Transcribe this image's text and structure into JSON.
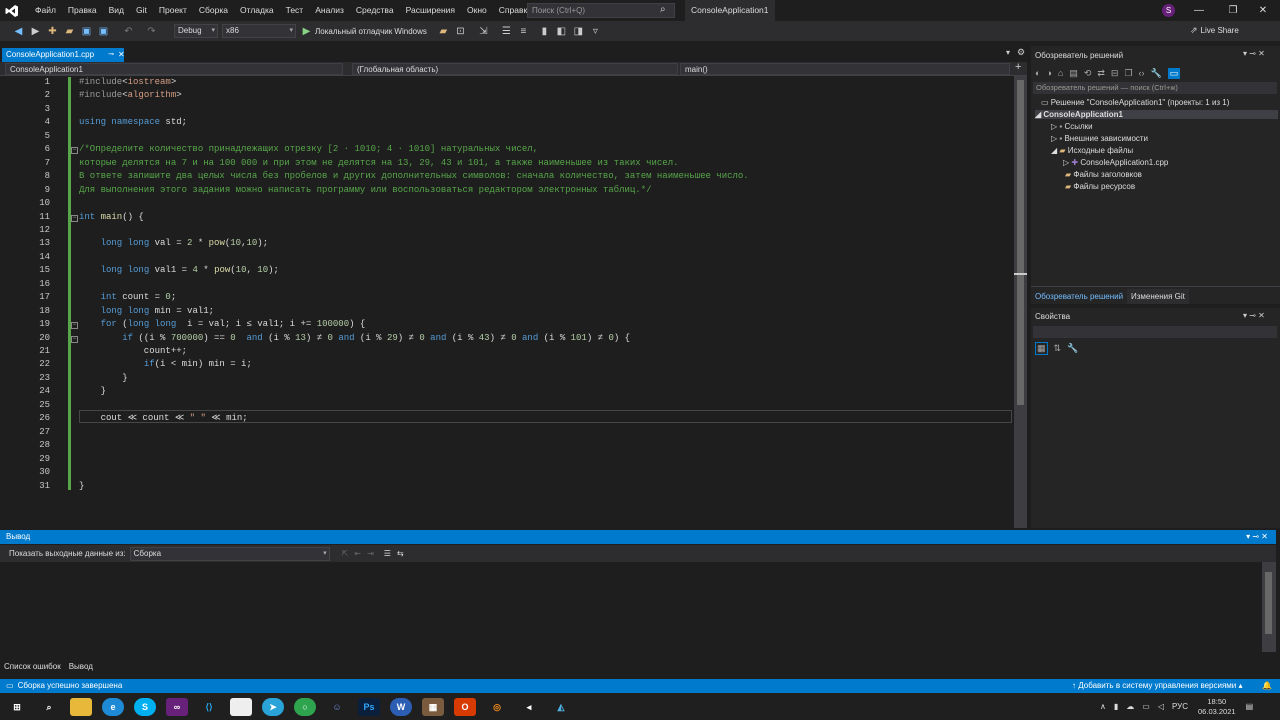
{
  "menu": [
    "Файл",
    "Правка",
    "Вид",
    "Git",
    "Проект",
    "Сборка",
    "Отладка",
    "Тест",
    "Анализ",
    "Средства",
    "Расширения",
    "Окно",
    "Справка"
  ],
  "search_placeholder": "Поиск (Ctrl+Q)",
  "app_title": "ConsoleApplication1",
  "avatar_letter": "S",
  "toolbar": {
    "config": "Debug",
    "platform": "x86",
    "debugger": "Локальный отладчик Windows",
    "live_share": "Live Share"
  },
  "tab": {
    "filename": "ConsoleApplication1.cpp"
  },
  "nav": {
    "project": "ConsoleApplication1",
    "scope": "(Глобальная область)",
    "member": "main()"
  },
  "code_lines": [
    "#include<iostream>",
    "#include<algorithm>",
    "",
    "using namespace std;",
    "",
    "/*Определите количество принадлежащих отрезку [2 · 1010; 4 · 1010] натуральных чисел,",
    "которые делятся на 7 и на 100 000 и при этом не делятся на 13, 29, 43 и 101, а также наименьшее из таких чисел.",
    "В ответе запишите два целых числа без пробелов и других дополнительных символов: сначала количество, затем наименьшее число.",
    "Для выполнения этого задания можно написать программу или воспользоваться редактором электронных таблиц.*/",
    "",
    "int main() {",
    "",
    "    long long val = 2 * pow(10,10);",
    "",
    "    long long val1 = 4 * pow(10, 10);",
    "",
    "    int count = 0;",
    "    long long min = val1;",
    "    for (long long  i = val; i ≤ val1; i += 100000) {",
    "        if ((i % 700000) == 0  and (i % 13) ≠ 0 and (i % 29) ≠ 0 and (i % 43) ≠ 0 and (i % 101) ≠ 0) {",
    "            count++;",
    "            if(i < min) min = i;",
    "        }",
    "    }",
    "",
    "    cout ≪ count ≪ \" \" ≪ min;",
    "",
    "",
    "",
    "",
    "}"
  ],
  "solution": {
    "title": "Обозреватель решений",
    "search": "Обозреватель решений — поиск (Ctrl+ж)",
    "root": "Решение \"ConsoleApplication1\" (проекты: 1 из 1)",
    "project": "ConsoleApplication1",
    "items": [
      "Ссылки",
      "Внешние зависимости",
      "Исходные файлы",
      "ConsoleApplication1.cpp",
      "Файлы заголовков",
      "Файлы ресурсов"
    ],
    "tabs": [
      "Обозреватель решений",
      "Изменения Git"
    ]
  },
  "properties": {
    "title": "Свойства"
  },
  "output": {
    "title": "Вывод",
    "show_label": "Показать выходные данные из:",
    "source": "Сборка"
  },
  "bottom_tabs": [
    "Список ошибок",
    "Вывод"
  ],
  "status": {
    "message": "Сборка успешно завершена",
    "vcs": "Добавить в систему управления версиями"
  },
  "taskbar": {
    "lang": "РУС",
    "time": "18:50",
    "date": "06.03.2021"
  }
}
